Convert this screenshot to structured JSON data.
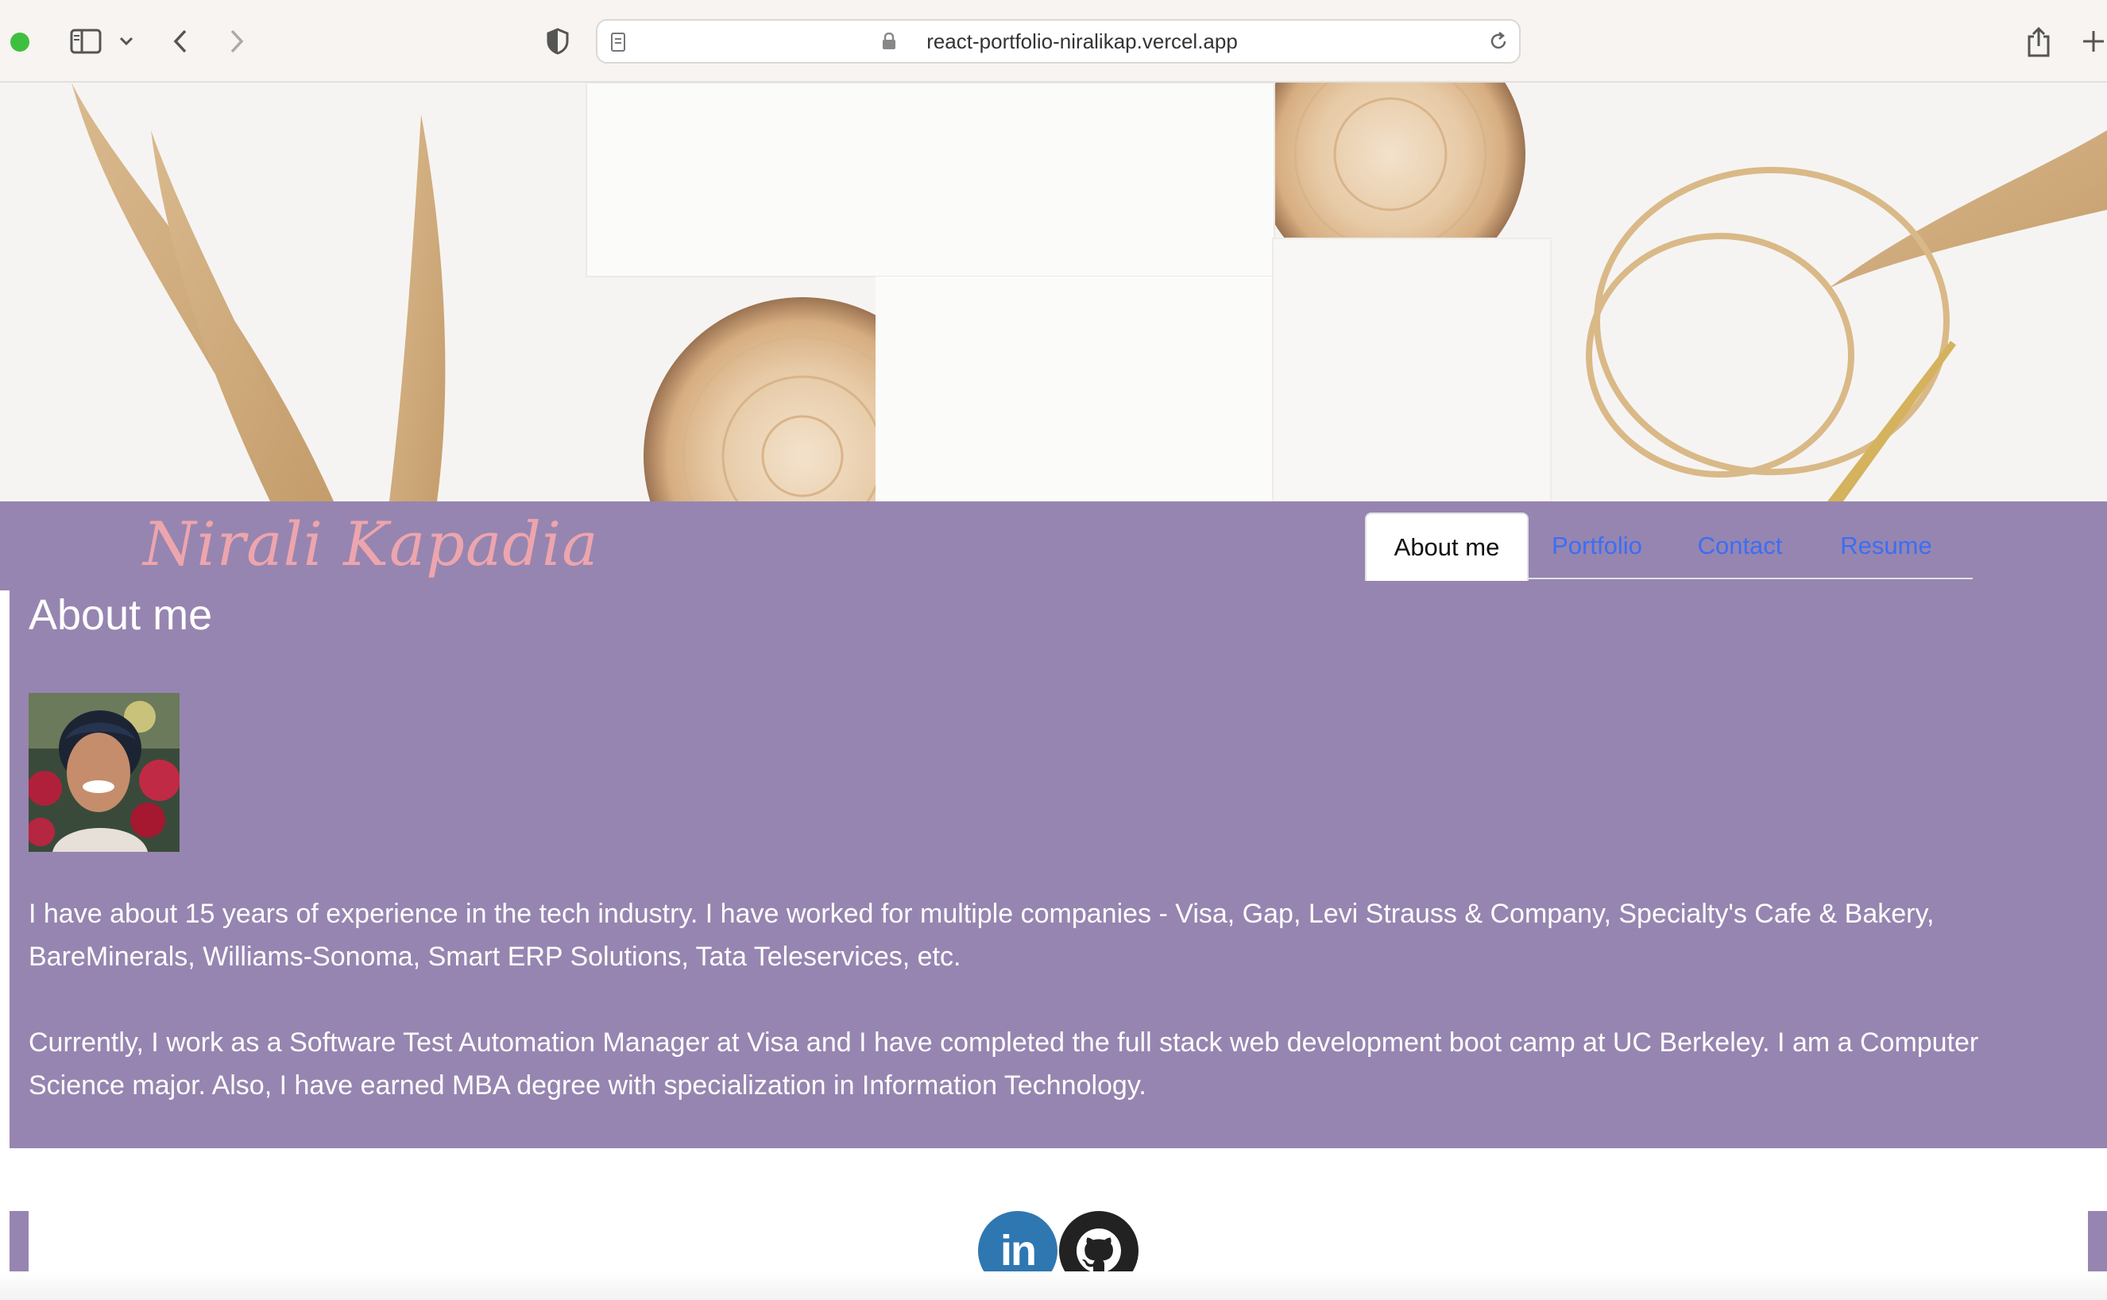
{
  "browser": {
    "url": "react-portfolio-niralikap.vercel.app"
  },
  "site": {
    "title": "Nirali Kapadia"
  },
  "nav": {
    "items": [
      {
        "label": "About me",
        "active": true
      },
      {
        "label": "Portfolio",
        "active": false
      },
      {
        "label": "Contact",
        "active": false
      },
      {
        "label": "Resume",
        "active": false
      }
    ]
  },
  "about": {
    "heading": "About me",
    "paragraph1": "I have about 15 years of experience in the tech industry. I have worked for multiple companies - Visa, Gap, Levi Strauss & Company, Specialty's Cafe & Bakery, BareMinerals, Williams-Sonoma, Smart ERP Solutions, Tata Teleservices, etc.",
    "paragraph2": "Currently, I work as a Software Test Automation Manager at Visa and I have completed the full stack web development boot camp at UC Berkeley. I am a Computer Science major. Also, I have earned MBA degree with specialization in Information Technology."
  },
  "footer": {
    "linkedin_label": "in",
    "icons": [
      "linkedin-icon",
      "github-icon"
    ]
  },
  "colors": {
    "accent": "#9685b0",
    "title": "#eda5ad",
    "link": "#3b6ef5"
  }
}
